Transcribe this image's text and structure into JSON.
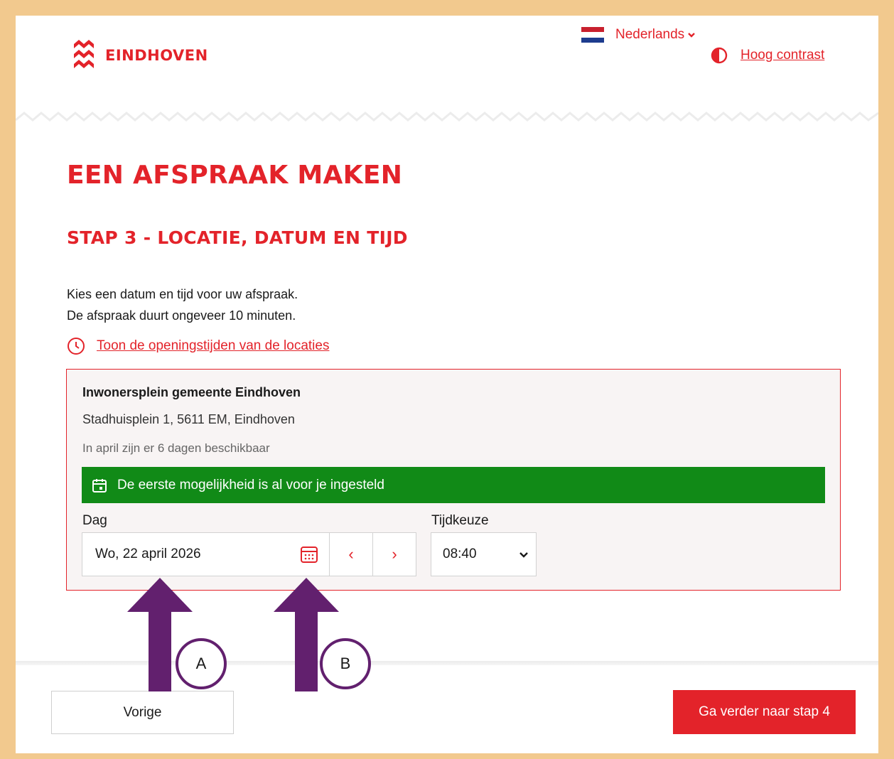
{
  "header": {
    "logo_text": "EINDHOVEN",
    "language": "Nederlands",
    "contrast_link": "Hoog contrast"
  },
  "main": {
    "title": "EEN AFSPRAAK MAKEN",
    "step_title": "STAP 3 - LOCATIE, DATUM EN TIJD",
    "intro_line1": "Kies een datum en tijd voor uw afspraak.",
    "intro_line2": "De afspraak duurt ongeveer 10 minuten.",
    "opening_hours_link": "Toon de openingstijden van de locaties"
  },
  "location": {
    "name": "Inwonersplein gemeente Eindhoven",
    "address": "Stadhuisplein 1, 5611 EM, Eindhoven",
    "availability": "In april zijn er 6 dagen beschikbaar",
    "banner": "De eerste mogelijkheid is al voor je ingesteld",
    "day_label": "Dag",
    "day_value": "Wo, 22 april 2026",
    "prev_day_icon": "‹",
    "next_day_icon": "›",
    "time_label": "Tijdkeuze",
    "time_value": "08:40"
  },
  "footer": {
    "prev_button": "Vorige",
    "next_button": "Ga verder naar stap 4"
  },
  "annotations": {
    "marker_a": "A",
    "marker_b": "B"
  },
  "colors": {
    "brand_red": "#e3232a",
    "success_green": "#118a17",
    "frame": "#f2c98e",
    "annotation_purple": "#62206e"
  }
}
